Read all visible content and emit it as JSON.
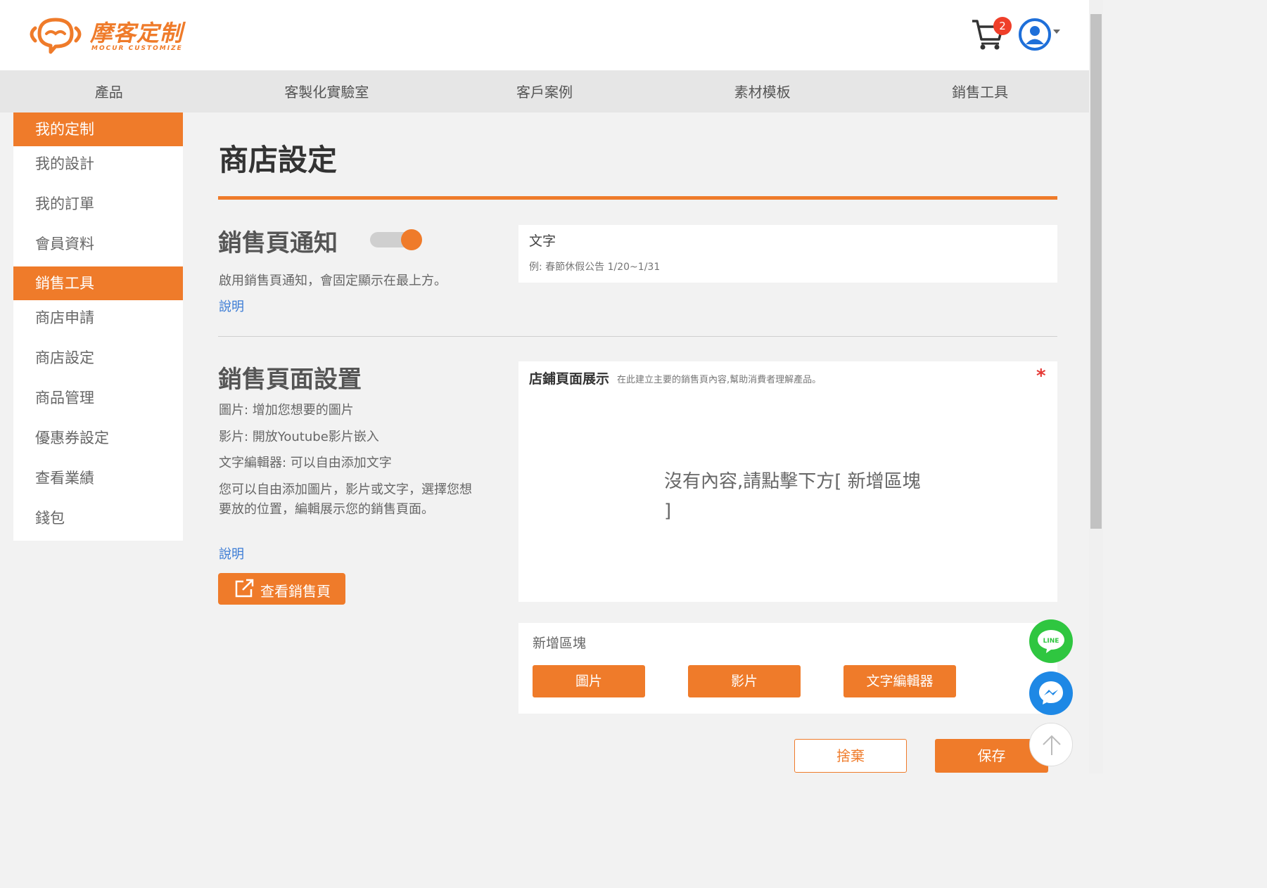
{
  "brand": {
    "name": "摩客定制",
    "sub": "MOCUR CUSTOMIZE",
    "accent": "#ef7b2a"
  },
  "header": {
    "cart_count": "2"
  },
  "nav": [
    "產品",
    "客製化實驗室",
    "客戶案例",
    "素材模板",
    "銷售工具"
  ],
  "sidebar": [
    {
      "label": "我的定制",
      "active": true
    },
    {
      "label": "我的設計",
      "active": false
    },
    {
      "label": "我的訂單",
      "active": false
    },
    {
      "label": "會員資料",
      "active": false
    },
    {
      "label": "銷售工具",
      "active": true
    },
    {
      "label": "商店申請",
      "active": false
    },
    {
      "label": "商店設定",
      "active": false
    },
    {
      "label": "商品管理",
      "active": false
    },
    {
      "label": "優惠券設定",
      "active": false
    },
    {
      "label": "查看業績",
      "active": false
    },
    {
      "label": "錢包",
      "active": false
    }
  ],
  "page": {
    "title": "商店設定"
  },
  "notice": {
    "title": "銷售頁通知",
    "toggle_on": true,
    "desc": "啟用銷售頁通知，會固定顯示在最上方。",
    "help": "說明",
    "field_label": "文字",
    "field_placeholder": "例: 春節休假公告 1/20~1/31"
  },
  "layout_section": {
    "title": "銷售頁面設置",
    "line1": "圖片: 增加您想要的圖片",
    "line2": "影片: 開放Youtube影片嵌入",
    "line3": "文字編輯器: 可以自由添加文字",
    "line4": "您可以自由添加圖片，影片或文字，選擇您想要放的位置，編輯展示您的銷售頁面。",
    "help": "說明",
    "preview_button": "查看銷售頁"
  },
  "content": {
    "label": "店鋪頁面展示",
    "hint": "在此建立主要的銷售頁內容,幫助消費者理解產品。",
    "required": "*",
    "empty": "沒有內容,請點擊下方[ 新增區塊 ]"
  },
  "add_block": {
    "label": "新增區塊",
    "image": "圖片",
    "video": "影片",
    "text_editor": "文字編輯器"
  },
  "actions": {
    "cancel": "捨棄",
    "save": "保存"
  },
  "floating": {
    "line": "LINE"
  }
}
